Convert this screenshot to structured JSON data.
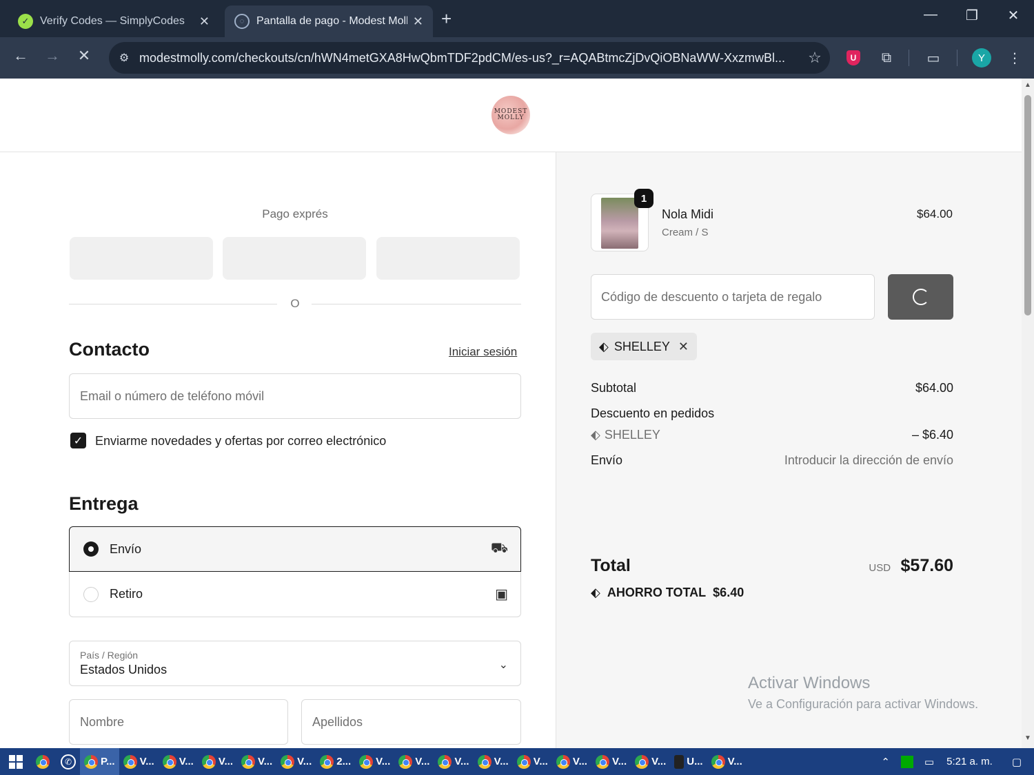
{
  "browser": {
    "tabs": [
      {
        "title": "Verify Codes — SimplyCodes",
        "active": false,
        "favicon": "simplycodes-icon"
      },
      {
        "title": "Pantalla de pago - Modest Molly",
        "active": true,
        "favicon": "loading-icon"
      }
    ],
    "url": "modestmolly.com/checkouts/cn/hWN4metGXA8HwQbmTDF2pdCM/es-us?_r=AQABtmcZjDvQiOBNaWW-XxzmwBl...",
    "profile_initial": "Y",
    "extension_badge": "U"
  },
  "store": {
    "logo_line1": "MODEST",
    "logo_line2": "MOLLY"
  },
  "checkout": {
    "express_title": "Pago exprés",
    "divider": "O",
    "contact": {
      "heading": "Contacto",
      "login_link": "Iniciar sesión",
      "email_placeholder": "Email o número de teléfono móvil",
      "newsletter_label": "Enviarme novedades y ofertas por correo electrónico",
      "newsletter_checked": true
    },
    "delivery": {
      "heading": "Entrega",
      "options": [
        {
          "label": "Envío",
          "selected": true,
          "icon": "truck-icon"
        },
        {
          "label": "Retiro",
          "selected": false,
          "icon": "store-icon"
        }
      ],
      "country_label": "País / Región",
      "country_value": "Estados Unidos",
      "first_name_placeholder": "Nombre",
      "last_name_placeholder": "Apellidos"
    }
  },
  "summary": {
    "product": {
      "name": "Nola Midi",
      "variant": "Cream / S",
      "price": "$64.00",
      "quantity": "1"
    },
    "discount_placeholder": "Código de descuento o tarjeta de regalo",
    "applied_code": "SHELLEY",
    "subtotal_label": "Subtotal",
    "subtotal_value": "$64.00",
    "order_discount_label": "Descuento en pedidos",
    "order_discount_code": "SHELLEY",
    "order_discount_value": "– $6.40",
    "shipping_label": "Envío",
    "shipping_value": "Introducir la dirección de envío",
    "total_label": "Total",
    "total_currency": "USD",
    "total_value": "$57.60",
    "savings_label": "AHORRO TOTAL",
    "savings_value": "$6.40"
  },
  "watermark": {
    "line1": "Activar Windows",
    "line2": "Ve a Configuración para activar Windows."
  },
  "taskbar": {
    "apps": [
      "P...",
      "V...",
      "V...",
      "V...",
      "V...",
      "V...",
      "2...",
      "V...",
      "V...",
      "V...",
      "V...",
      "V...",
      "V...",
      "V...",
      "V...",
      "U...",
      "V..."
    ],
    "time": "5:21 a. m."
  }
}
